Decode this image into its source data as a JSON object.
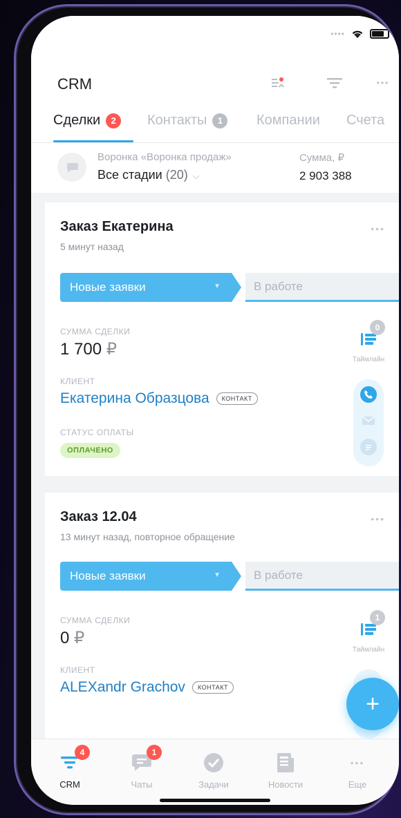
{
  "header": {
    "title": "CRM"
  },
  "tabs": [
    {
      "label": "Сделки",
      "badge": "2"
    },
    {
      "label": "Контакты",
      "badge": "1"
    },
    {
      "label": "Компании"
    },
    {
      "label": "Счета"
    }
  ],
  "funnel": {
    "name": "Воронка «Воронка продаж»",
    "stage": "Все стадии",
    "count": "(20)",
    "sum_label": "Сумма, ₽",
    "sum_value": "2 903 388"
  },
  "labels": {
    "deal_sum": "СУММА СДЕЛКИ",
    "client": "КЛИЕНТ",
    "payment_status": "СТАТУС ОПЛАТЫ",
    "timeline": "Таймлайн",
    "contact_tag": "КОНТАКТ",
    "more": "•••",
    "currency": "₽"
  },
  "deals": [
    {
      "title": "Заказ Екатерина",
      "subtitle": "5 минут назад",
      "stage": "Новые заявки",
      "next_stage": "В работе",
      "amount": "1 700",
      "client": "Екатерина Образцова",
      "payment_status": "ОПЛАЧЕНО",
      "timeline_count": "0"
    },
    {
      "title": "Заказ 12.04",
      "subtitle": "13 минут назад, повторное обращение",
      "stage": "Новые заявки",
      "next_stage": "В работе",
      "amount": "0",
      "client": "ALEXandr Grachov",
      "timeline_count": "1"
    }
  ],
  "fab": {
    "label": "+"
  },
  "tabbar": [
    {
      "label": "CRM",
      "badge": "4",
      "icon": "crm-filter-icon"
    },
    {
      "label": "Чаты",
      "badge": "1",
      "icon": "chat-icon"
    },
    {
      "label": "Задачи",
      "icon": "check-circle-icon"
    },
    {
      "label": "Новости",
      "icon": "news-icon"
    },
    {
      "label": "Еще",
      "icon": "more-icon"
    }
  ],
  "colors": {
    "accent": "#4fb8ef",
    "link": "#2180c5",
    "badge": "#ff5752",
    "paid_bg": "#ddf5c6",
    "paid_text": "#5d9c2a"
  }
}
